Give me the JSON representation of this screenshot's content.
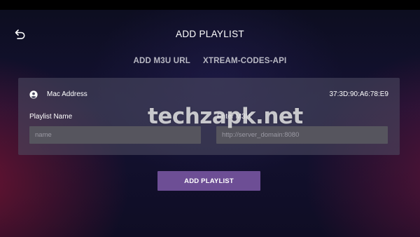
{
  "header": {
    "title": "ADD PLAYLIST"
  },
  "tabs": [
    {
      "label": "ADD M3U URL"
    },
    {
      "label": "XTREAM-CODES-API"
    }
  ],
  "device": {
    "mac_label": "Mac Address",
    "mac_value": "37:3D:90:A6:78:E9"
  },
  "form": {
    "playlist_name_label": "Playlist Name",
    "playlist_name_placeholder": "name",
    "m3u_label": "Enter M3U",
    "m3u_placeholder": "http://server_domain:8080"
  },
  "actions": {
    "add_label": "ADD PLAYLIST"
  },
  "watermark": {
    "text": "techzapk.net"
  },
  "icons": {
    "back": "back-arrow-icon",
    "user": "account-circle-icon"
  },
  "colors": {
    "button": "#6d4e95",
    "panel": "#4f4e64",
    "input": "#56555e"
  }
}
